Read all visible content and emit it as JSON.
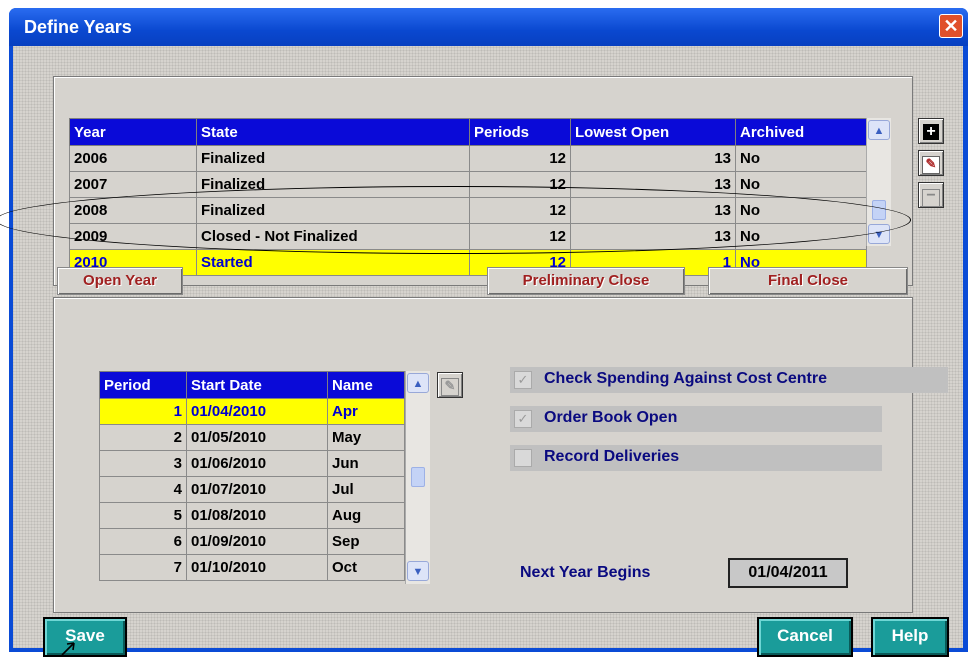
{
  "window": {
    "title": "Define Years",
    "close_glyph": "✕"
  },
  "years_table": {
    "columns": [
      "Year",
      "State",
      "Periods",
      "Lowest Open",
      "Archived"
    ],
    "rows": [
      {
        "year": "2006",
        "state": "Finalized",
        "periods": "12",
        "lowest_open": "13",
        "archived": "No"
      },
      {
        "year": "2007",
        "state": "Finalized",
        "periods": "12",
        "lowest_open": "13",
        "archived": "No"
      },
      {
        "year": "2008",
        "state": "Finalized",
        "periods": "12",
        "lowest_open": "13",
        "archived": "No"
      },
      {
        "year": "2009",
        "state": "Closed - Not Finalized",
        "periods": "12",
        "lowest_open": "13",
        "archived": "No"
      },
      {
        "year": "2010",
        "state": "Started",
        "periods": "12",
        "lowest_open": "1",
        "archived": "No"
      }
    ],
    "selected_row": 4
  },
  "side_buttons": {
    "add_icon": "plus-icon",
    "edit_icon": "pencil-icon",
    "delete_icon": "minus-icon"
  },
  "buttons": {
    "open_year": "Open Year",
    "preliminary_close": "Preliminary Close",
    "final_close": "Final Close",
    "save": "Save",
    "cancel": "Cancel",
    "help": "Help"
  },
  "periods_table": {
    "columns": [
      "Period",
      "Start Date",
      "Name"
    ],
    "rows": [
      {
        "period": "1",
        "start": "01/04/2010",
        "name": "Apr"
      },
      {
        "period": "2",
        "start": "01/05/2010",
        "name": "May"
      },
      {
        "period": "3",
        "start": "01/06/2010",
        "name": "Jun"
      },
      {
        "period": "4",
        "start": "01/07/2010",
        "name": "Jul"
      },
      {
        "period": "5",
        "start": "01/08/2010",
        "name": "Aug"
      },
      {
        "period": "6",
        "start": "01/09/2010",
        "name": "Sep"
      },
      {
        "period": "7",
        "start": "01/10/2010",
        "name": "Oct"
      }
    ],
    "selected_row": 0
  },
  "options": {
    "check_spending": {
      "label": "Check Spending Against Cost Centre",
      "checked": true
    },
    "order_book_open": {
      "label": "Order Book Open",
      "checked": true
    },
    "record_deliveries": {
      "label": "Record Deliveries",
      "checked": false
    }
  },
  "next_year": {
    "label": "Next Year Begins",
    "value": "01/04/2011"
  },
  "colors": {
    "header_blue": "#0a0ad8",
    "selected_yellow": "#ffff00",
    "action_teal": "#1a9c9a"
  }
}
